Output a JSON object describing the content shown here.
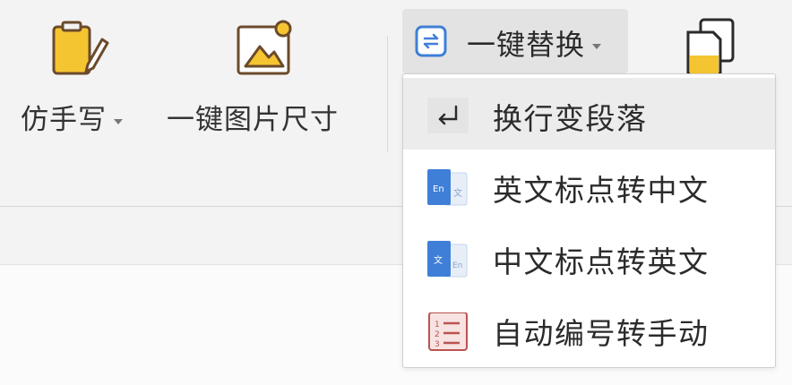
{
  "toolbar": {
    "fake_handwriting": {
      "label": "仿手写",
      "icon": "notepad-pencil-icon"
    },
    "image_resize": {
      "label": "一键图片尺寸",
      "icon": "image-frame-icon"
    },
    "one_click_replace": {
      "label": "一键替换",
      "icon": "replace-arrows-icon"
    },
    "copy_doc": {
      "icon": "copy-document-icon"
    }
  },
  "dropdown": {
    "items": [
      {
        "label": "换行变段落",
        "icon": "line-break-arrow-icon"
      },
      {
        "label": "英文标点转中文",
        "icon": "en-to-zh-punctuation-icon"
      },
      {
        "label": "中文标点转英文",
        "icon": "zh-to-en-punctuation-icon"
      },
      {
        "label": "自动编号转手动",
        "icon": "numbered-list-icon"
      }
    ]
  },
  "colors": {
    "accent_blue": "#3f7fd8",
    "accent_yellow": "#f5c531",
    "icon_brown": "#6b4a2b",
    "list_icon_red": "#b95450"
  }
}
